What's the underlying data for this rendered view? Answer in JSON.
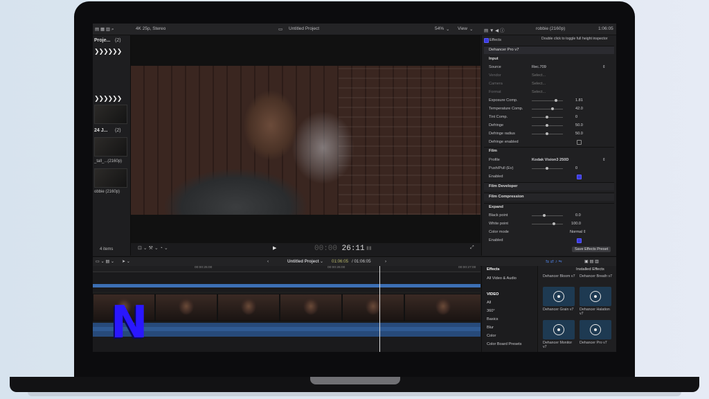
{
  "topbar": {
    "format": "4K 25p, Stereo",
    "project": "Untitled Project",
    "zoom": "54%",
    "view": "View",
    "clip_name": "robbie (2160p)",
    "duration": "1:06:05"
  },
  "browser": {
    "title": "Proje...",
    "count": "(2)",
    "group2_title": "24 J...",
    "group2_count": "(2)",
    "clip1_label": "_tall_...(2160p)",
    "clip2_label": "obbie (2160p)",
    "items_count": "4 items"
  },
  "viewer": {
    "timecode_dim": "00:00",
    "timecode": "26:11"
  },
  "inspector": {
    "effects_label": "Effects",
    "hint": "Double click to toggle full height inspector",
    "plugin": "Dehancer Pro v7",
    "input_section": "Input",
    "source_label": "Source",
    "source_value": "Rec.709",
    "vendor_label": "Vendor",
    "camera_label": "Camera",
    "format_label": "Format",
    "select": "Select...",
    "exposure_label": "Exposure Comp.",
    "exposure_value": "1.81",
    "temperature_label": "Temperature Comp.",
    "temperature_value": "42.0",
    "tint_label": "Tint Comp.",
    "tint_value": "0",
    "defringe_label": "Defringe",
    "defringe_value": "50.0",
    "defringe_radius_label": "Defringe radius",
    "defringe_radius_value": "50.0",
    "defringe_enabled_label": "Defringe enabled",
    "film_section": "Film",
    "profile_label": "Profile",
    "profile_value": "Kodak Vision3 250D",
    "pushpull_label": "Push/Pull (Ev)",
    "pushpull_value": "0",
    "enabled_label": "Enabled",
    "film_developer": "Film Developer",
    "film_compression": "Film Compression",
    "expand_section": "Expand",
    "black_point_label": "Black point",
    "black_point_value": "0.0",
    "white_point_label": "White point",
    "white_point_value": "100.0",
    "color_mode_label": "Color mode",
    "color_mode_value": "Normal",
    "enabled2_label": "Enabled",
    "save_preset": "Save Effects Preset"
  },
  "timeline_toolbar": {
    "project": "Untitled Project",
    "position": "01:06:05",
    "total": "/ 01:06:05"
  },
  "ruler": [
    "00:00:25:00",
    "00:00:26:00",
    "00:00:27:00"
  ],
  "logo": {
    "letter": "N",
    "color": "#2a17ff"
  },
  "effects": {
    "title": "Effects",
    "installed": "Installed Effects",
    "categories": [
      "All Video & Audio",
      "VIDEO",
      "All",
      "360°",
      "Basics",
      "Blur",
      "Color",
      "Color Board Presets"
    ],
    "tiles": [
      "Dehancer Bloom v7",
      "Dehancer Breath v7",
      "Dehancer Grain v7",
      "Dehancer Halation v7",
      "Dehancer Monitor v7",
      "Dehancer Pro v7"
    ]
  }
}
